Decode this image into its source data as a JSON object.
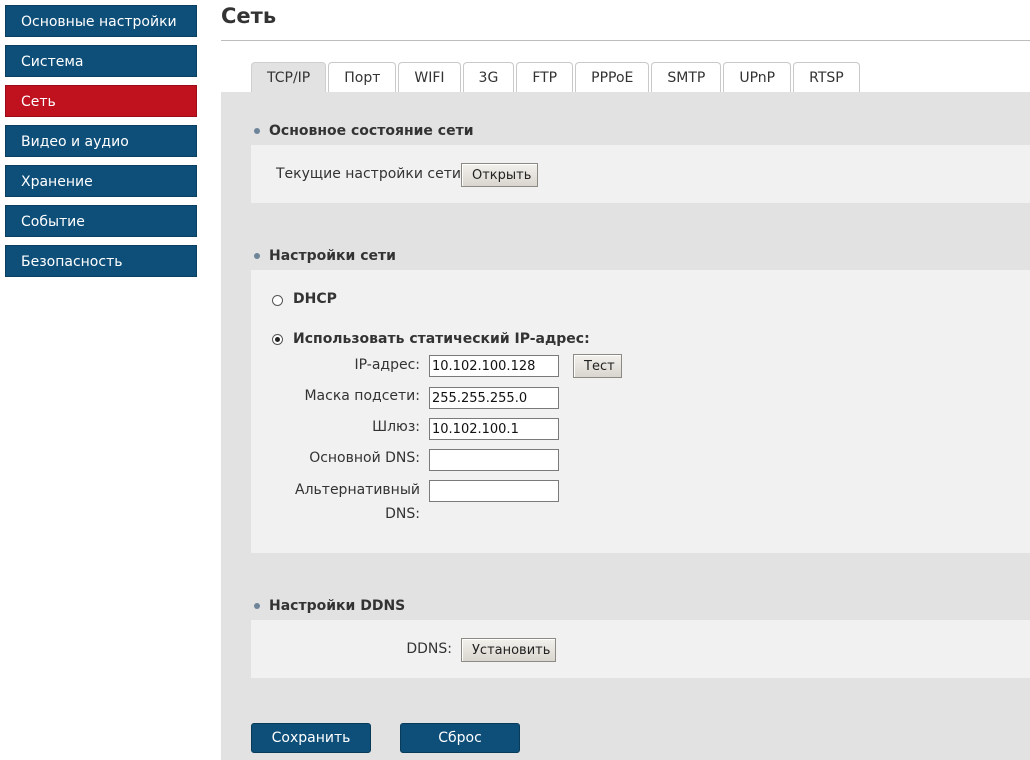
{
  "sidebar": {
    "items": [
      {
        "label": "Основные настройки"
      },
      {
        "label": "Система"
      },
      {
        "label": "Сеть"
      },
      {
        "label": "Видео и аудио"
      },
      {
        "label": "Хранение"
      },
      {
        "label": "Событие"
      },
      {
        "label": "Безопасность"
      }
    ]
  },
  "page": {
    "title": "Сеть"
  },
  "tabs": [
    {
      "label": "TCP/IP"
    },
    {
      "label": "Порт"
    },
    {
      "label": "WIFI"
    },
    {
      "label": "3G"
    },
    {
      "label": "FTP"
    },
    {
      "label": "PPPoE"
    },
    {
      "label": "SMTP"
    },
    {
      "label": "UPnP"
    },
    {
      "label": "RTSP"
    }
  ],
  "basic_status": {
    "title": "Основное состояние сети",
    "current_label": "Текущие настройки сети:",
    "open_button": "Открыть"
  },
  "network_settings": {
    "title": "Настройки сети",
    "dhcp_label": "DHCP",
    "static_label": "Использовать статический IP-адрес:",
    "ip_label": "IP-адрес:",
    "ip_value": "10.102.100.128",
    "test_button": "Тест",
    "mask_label": "Маска подсети:",
    "mask_value": "255.255.255.0",
    "gateway_label": "Шлюз:",
    "gateway_value": "10.102.100.1",
    "dns1_label": "Основной DNS:",
    "dns1_value": "",
    "dns2_label_line1": "Альтернативный",
    "dns2_label_line2": "DNS:",
    "dns2_value": ""
  },
  "ddns": {
    "title": "Настройки DDNS",
    "label": "DDNS:",
    "install_button": "Установить"
  },
  "actions": {
    "save": "Сохранить",
    "reset": "Сброс"
  },
  "colors": {
    "nav": "#0e4f7a",
    "nav_active": "#c0111f",
    "panel": "#f1f1f1",
    "background": "#e2e2e2"
  }
}
